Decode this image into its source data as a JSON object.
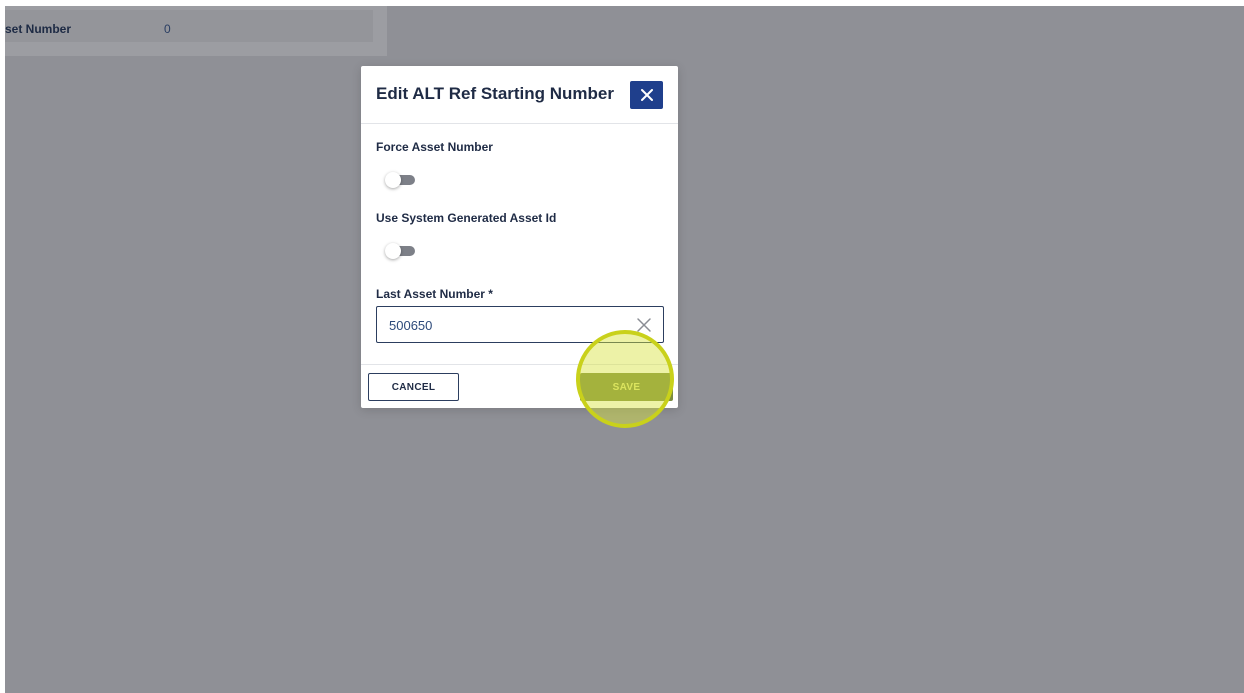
{
  "background": {
    "row_label": "set Number",
    "row_value": "0"
  },
  "modal": {
    "title": "Edit ALT Ref Starting Number",
    "fields": {
      "force_asset_number": {
        "label": "Force Asset Number",
        "enabled": false
      },
      "use_system_generated_asset_id": {
        "label": "Use System Generated Asset Id",
        "enabled": false
      },
      "last_asset_number": {
        "label": "Last Asset Number *",
        "value": "500650"
      }
    },
    "buttons": {
      "cancel_label": "CANCEL",
      "save_label": "SAVE"
    }
  },
  "colors": {
    "overlay": "#8f9096",
    "primary_dark": "#1f3f8c",
    "text_dark": "#1f2b45",
    "highlight": "#c9d11b"
  },
  "icons": {
    "close": "close-icon",
    "clear": "clear-icon"
  }
}
